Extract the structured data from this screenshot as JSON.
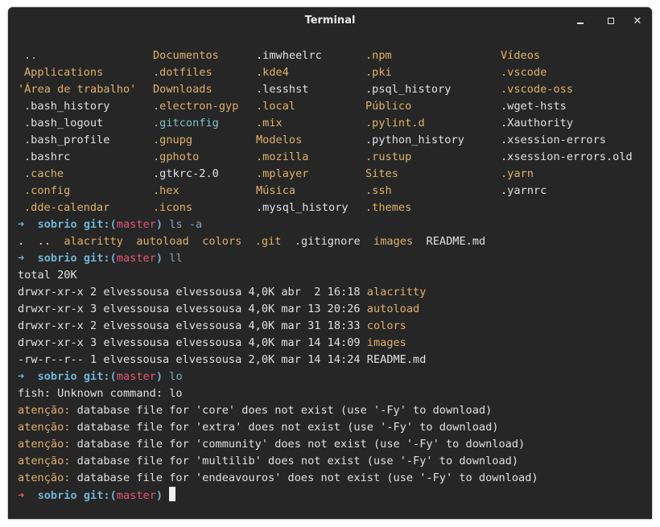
{
  "window": {
    "title": "Terminal"
  },
  "ls_grid": {
    "columns": [
      [
        "..",
        "Applications",
        "'Área de trabalho'",
        ".bash_history",
        ".bash_logout",
        ".bash_profile",
        ".bashrc",
        ".cache",
        ".config",
        ".dde-calendar"
      ],
      [
        "Documentos",
        ".dotfiles",
        "Downloads",
        ".electron-gyp",
        ".gitconfig",
        ".gnupg",
        ".gphoto",
        ".gtkrc-2.0",
        ".hex",
        ".icons"
      ],
      [
        ".imwheelrc",
        ".kde4",
        ".lesshst",
        ".local",
        ".mix",
        "Modelos",
        ".mozilla",
        ".mplayer",
        "Música",
        ".mysql_history"
      ],
      [
        ".npm",
        ".pki",
        ".psql_history",
        "Público",
        ".pylint.d",
        ".python_history",
        ".rustup",
        "Sites",
        ".ssh",
        ".themes"
      ],
      [
        "Vídeos",
        ".vscode",
        ".vscode-oss",
        ".wget-hsts",
        ".Xauthority",
        ".xsession-errors",
        ".xsession-errors.old",
        ".yarn",
        ".yarnrc"
      ]
    ]
  },
  "prompt": {
    "arrow": "➜",
    "dir": "sobrio",
    "git_label": "git:(",
    "branch": "master",
    "git_close": ")"
  },
  "cmd1": "ls -a",
  "ls_a_output": [
    ".",
    "..",
    "alacritty",
    "autoload",
    "colors",
    ".git",
    ".gitignore",
    "images",
    "README.md"
  ],
  "cmd2": "ll",
  "ll_total": "total 20K",
  "ll_rows": [
    {
      "meta": "drwxr-xr-x 2 elvessousa elvessousa 4,0K abr  2 16:18 ",
      "name": "alacritty"
    },
    {
      "meta": "drwxr-xr-x 3 elvessousa elvessousa 4,0K mar 13 20:26 ",
      "name": "autoload"
    },
    {
      "meta": "drwxr-xr-x 2 elvessousa elvessousa 4,0K mar 31 18:33 ",
      "name": "colors"
    },
    {
      "meta": "drwxr-xr-x 3 elvessousa elvessousa 4,0K mar 14 14:09 ",
      "name": "images"
    },
    {
      "meta": "-rw-r--r-- 1 elvessousa elvessousa 2,0K mar 14 14:24 ",
      "name": "README.md"
    }
  ],
  "cmd3": "lo",
  "fish_error": "fish: Unknown command: lo",
  "warnings": [
    {
      "label": "atenção:",
      "text": " database file for 'core' does not exist (use '-Fy' to download)"
    },
    {
      "label": "atenção:",
      "text": " database file for 'extra' does not exist (use '-Fy' to download)"
    },
    {
      "label": "atenção:",
      "text": " database file for 'community' does not exist (use '-Fy' to download)"
    },
    {
      "label": "atenção:",
      "text": " database file for 'multilib' does not exist (use '-Fy' to download)"
    },
    {
      "label": "atenção:",
      "text": " database file for 'endeavouros' does not exist (use '-Fy' to download)"
    }
  ],
  "colors": {
    "background": "#262626",
    "directory": "#e0b26a",
    "prompt": "#6fb4d6",
    "branch": "#e8557a",
    "gitconfig": "#7fc1c8"
  }
}
